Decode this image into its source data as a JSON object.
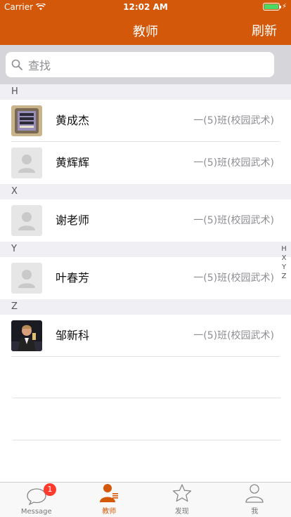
{
  "status_bar": {
    "carrier": "Carrier",
    "time": "12:02 AM"
  },
  "nav": {
    "title": "教师",
    "right_button": "刷新"
  },
  "search": {
    "placeholder": "查找"
  },
  "sections": [
    {
      "letter": "H",
      "rows": [
        {
          "name": "黄成杰",
          "detail": "一(5)班(校园武术)",
          "avatar": "custom-photo-1"
        },
        {
          "name": "黄辉辉",
          "detail": "一(5)班(校园武术)",
          "avatar": "default-avatar"
        }
      ]
    },
    {
      "letter": "X",
      "rows": [
        {
          "name": "谢老师",
          "detail": "一(5)班(校园武术)",
          "avatar": "default-avatar"
        }
      ]
    },
    {
      "letter": "Y",
      "rows": [
        {
          "name": "叶春芳",
          "detail": "一(5)班(校园武术)",
          "avatar": "default-avatar"
        }
      ]
    },
    {
      "letter": "Z",
      "rows": [
        {
          "name": "邹新科",
          "detail": "一(5)班(校园武术)",
          "avatar": "custom-photo-2"
        }
      ]
    }
  ],
  "index": [
    "H",
    "X",
    "Y",
    "Z"
  ],
  "tabbar": {
    "items": [
      {
        "label": "Message",
        "icon": "chat-bubble-icon",
        "badge": "1",
        "active": false
      },
      {
        "label": "教师",
        "icon": "teacher-icon",
        "active": true
      },
      {
        "label": "发现",
        "icon": "star-icon",
        "active": false
      },
      {
        "label": "我",
        "icon": "person-icon",
        "active": false
      }
    ]
  },
  "colors": {
    "brand": "#D4580A",
    "badge": "#FF3B30",
    "section_bg": "#EFEFF4"
  }
}
